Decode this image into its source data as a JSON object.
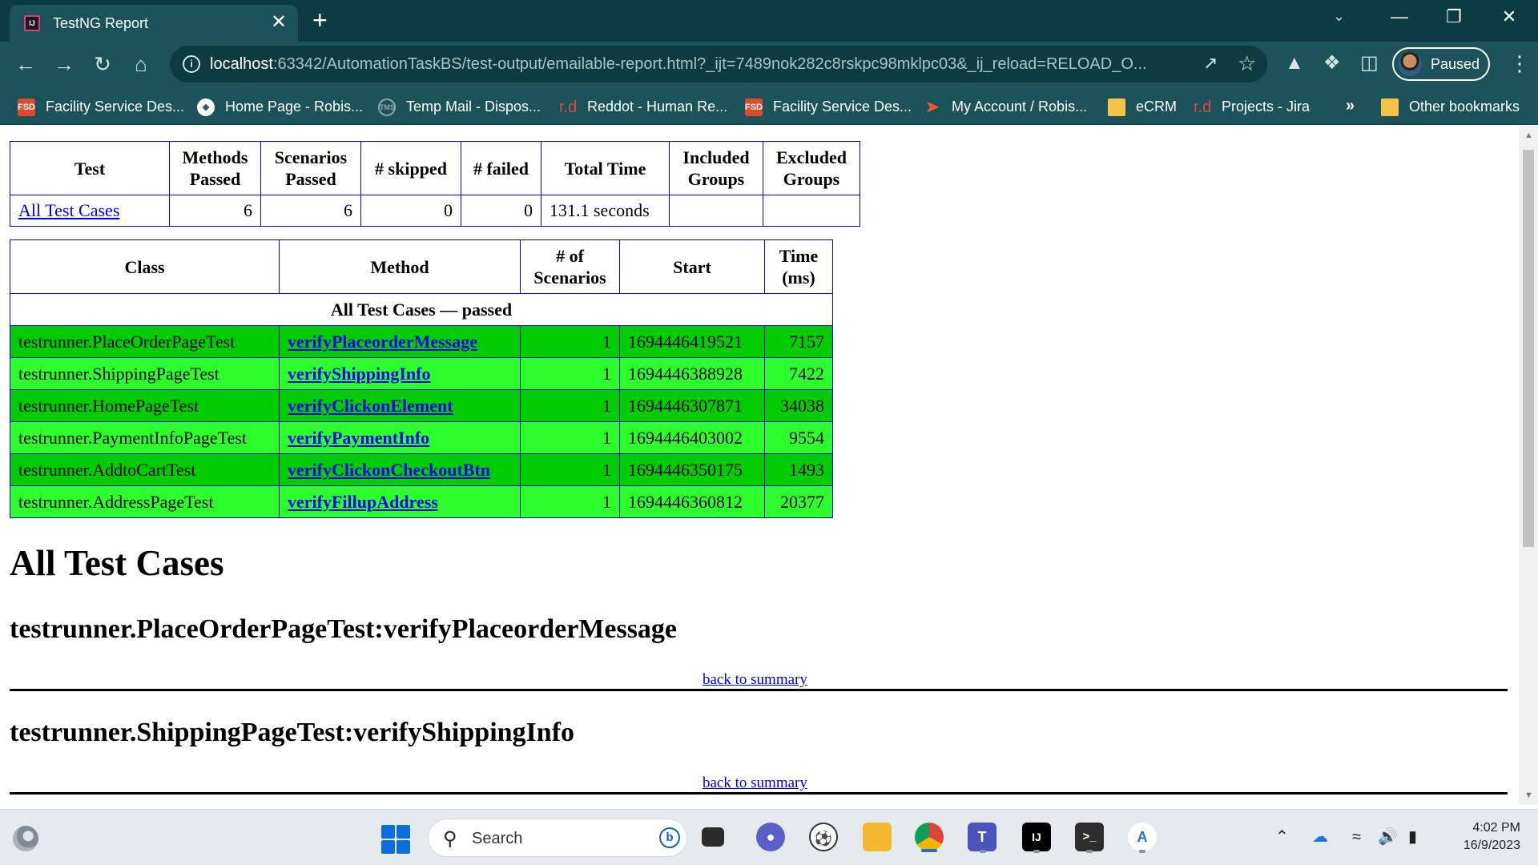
{
  "browser": {
    "tab_title": "TestNG Report",
    "tab_close": "✕",
    "new_tab": "+",
    "url_host": "localhost",
    "url_rest": ":63342/AutomationTaskBS/test-output/emailable-report.html?_ijt=7489nok282c8rskpc98mklpc03&_ij_reload=RELOAD_O...",
    "profile_status": "Paused"
  },
  "bookmarks": [
    {
      "label": "Facility Service Des...",
      "icon": "FSD",
      "kind": "fsd"
    },
    {
      "label": "Home Page - Robis...",
      "icon": "globe-icon",
      "kind": "globe"
    },
    {
      "label": "Temp Mail - Dispos...",
      "icon": "TMS",
      "kind": "tm"
    },
    {
      "label": "Reddot - Human Re...",
      "icon": "r.d",
      "kind": "rd"
    },
    {
      "label": "Facility Service Des...",
      "icon": "FSD",
      "kind": "fsd"
    },
    {
      "label": "My Account / Robis...",
      "icon": "account-icon",
      "kind": "acct"
    },
    {
      "label": "eCRM",
      "icon": "folder-icon",
      "kind": "folder"
    },
    {
      "label": "Projects - Jira",
      "icon": "r.d",
      "kind": "rd"
    },
    {
      "label": "Other bookmarks",
      "icon": "folder-icon",
      "kind": "folder"
    }
  ],
  "bookmarks_more": "»",
  "summary_table": {
    "headers": [
      "Test",
      "Methods Passed",
      "Scenarios Passed",
      "# skipped",
      "# failed",
      "Total Time",
      "Included Groups",
      "Excluded Groups"
    ],
    "row": {
      "test": "All Test Cases",
      "methods_passed": "6",
      "scenarios_passed": "6",
      "skipped": "0",
      "failed": "0",
      "total_time": "131.1 seconds",
      "included_groups": "",
      "excluded_groups": ""
    }
  },
  "class_table": {
    "headers": [
      "Class",
      "Method",
      "# of Scenarios",
      "Start",
      "Time (ms)"
    ],
    "group_label": "All Test Cases — passed",
    "rows": [
      {
        "class": "testrunner.PlaceOrderPageTest",
        "method": "verifyPlaceorderMessage",
        "scenarios": "1",
        "start": "1694446419521",
        "time": "7157",
        "shade": "dark"
      },
      {
        "class": "testrunner.ShippingPageTest",
        "method": "verifyShippingInfo",
        "scenarios": "1",
        "start": "1694446388928",
        "time": "7422",
        "shade": "light"
      },
      {
        "class": "testrunner.HomePageTest",
        "method": "verifyClickonElement",
        "scenarios": "1",
        "start": "1694446307871",
        "time": "34038",
        "shade": "dark"
      },
      {
        "class": "testrunner.PaymentInfoPageTest",
        "method": "verifyPaymentInfo",
        "scenarios": "1",
        "start": "1694446403002",
        "time": "9554",
        "shade": "light"
      },
      {
        "class": "testrunner.AddtoCartTest",
        "method": "verifyClickonCheckoutBtn",
        "scenarios": "1",
        "start": "1694446350175",
        "time": "1493",
        "shade": "dark"
      },
      {
        "class": "testrunner.AddressPageTest",
        "method": "verifyFillupAddress",
        "scenarios": "1",
        "start": "1694446360812",
        "time": "20377",
        "shade": "light"
      }
    ]
  },
  "detail": {
    "section_title": "All Test Cases",
    "tests": [
      {
        "heading": "testrunner.PlaceOrderPageTest:verifyPlaceorderMessage",
        "back_link": "back to summary"
      },
      {
        "heading": "testrunner.ShippingPageTest:verifyShippingInfo",
        "back_link": "back to summary"
      }
    ]
  },
  "taskbar": {
    "search_placeholder": "Search",
    "time": "4:02 PM",
    "date": "16/9/2023"
  },
  "colors": {
    "row_dark": "#00cc00",
    "row_light": "#2cff2c",
    "table_border": "#0000cc",
    "chrome_frame": "#0d3b43",
    "chrome_toolbar": "#1c535b"
  }
}
